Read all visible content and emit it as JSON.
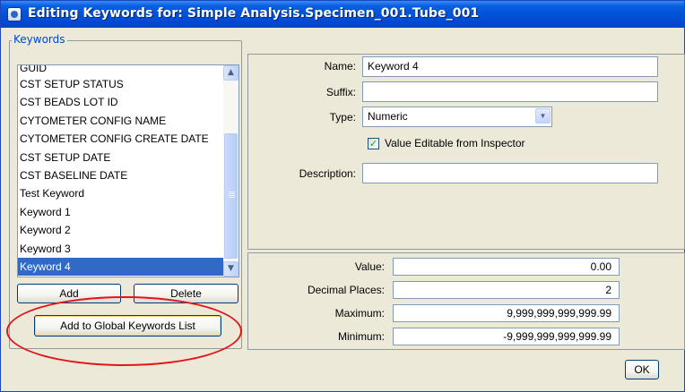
{
  "window": {
    "title": "Editing Keywords for: Simple Analysis.Specimen_001.Tube_001"
  },
  "keywords_group": {
    "legend": "Keywords",
    "items": [
      "GUID",
      "CST SETUP STATUS",
      "CST BEADS LOT ID",
      "CYTOMETER CONFIG NAME",
      "CYTOMETER CONFIG CREATE DATE",
      "CST SETUP DATE",
      "CST BASELINE DATE",
      "Test Keyword",
      "Keyword 1",
      "Keyword 2",
      "Keyword 3",
      "Keyword 4"
    ],
    "selected": "Keyword 4",
    "add_label": "Add",
    "delete_label": "Delete",
    "add_global_label": "Add to Global Keywords List"
  },
  "details": {
    "name_label": "Name:",
    "name_value": "Keyword 4",
    "suffix_label": "Suffix:",
    "suffix_value": "",
    "type_label": "Type:",
    "type_value": "Numeric",
    "editable_label": "Value Editable from Inspector",
    "editable_checked": true,
    "description_label": "Description:",
    "description_value": ""
  },
  "numeric": {
    "value_label": "Value:",
    "value": "0.00",
    "decimal_label": "Decimal Places:",
    "decimal_value": "2",
    "maximum_label": "Maximum:",
    "maximum_value": "9,999,999,999,999.99",
    "minimum_label": "Minimum:",
    "minimum_value": "-9,999,999,999,999.99"
  },
  "footer": {
    "ok_label": "OK"
  },
  "colors": {
    "title_bar": "#0052d6",
    "selection": "#316ac5",
    "annotation": "#e3141b",
    "legend_text": "#0046d5"
  }
}
